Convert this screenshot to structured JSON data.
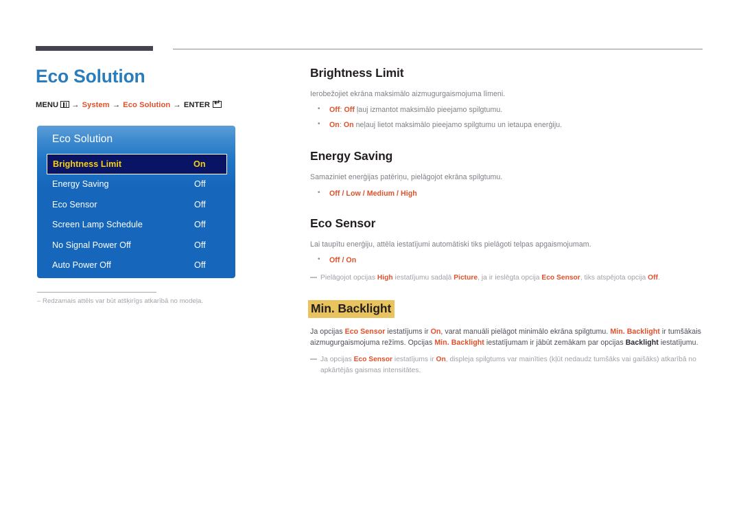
{
  "page": {
    "title": "Eco Solution",
    "breadcrumb": {
      "menu_label": "MENU",
      "menu_icon": "menu-grid-icon",
      "arrow": "→",
      "step1": "System",
      "step2": "Eco Solution",
      "enter_label": "ENTER",
      "enter_icon": "enter-key-icon"
    },
    "footnote": "Redzamais attēls var būt atšķirīgs atkarībā no modeļa."
  },
  "osd": {
    "title": "Eco Solution",
    "rows": [
      {
        "label": "Brightness Limit",
        "value": "On",
        "selected": true
      },
      {
        "label": "Energy Saving",
        "value": "Off",
        "selected": false
      },
      {
        "label": "Eco Sensor",
        "value": "Off",
        "selected": false
      },
      {
        "label": "Screen Lamp Schedule",
        "value": "Off",
        "selected": false
      },
      {
        "label": "No Signal Power Off",
        "value": "Off",
        "selected": false
      },
      {
        "label": "Auto Power Off",
        "value": "Off",
        "selected": false
      }
    ]
  },
  "sections": {
    "brightness_limit": {
      "title": "Brightness Limit",
      "intro": "Ierobežojiet ekrāna maksimālo aizmugurgaismojuma līmeni.",
      "bullet1_key": "Off",
      "bullet1_sep": ": ",
      "bullet1_val": "Off",
      "bullet1_text": " ļauj izmantot maksimālo pieejamo spilgtumu.",
      "bullet2_key": "On",
      "bullet2_sep": ": ",
      "bullet2_val": "On",
      "bullet2_text": " neļauj lietot maksimālo pieejamo spilgtumu un ietaupa enerģiju."
    },
    "energy_saving": {
      "title": "Energy Saving",
      "intro": "Samaziniet enerģijas patēriņu, pielāgojot ekrāna spilgtumu.",
      "options": "Off / Low / Medium / High"
    },
    "eco_sensor": {
      "title": "Eco Sensor",
      "intro": "Lai taupītu enerģiju, attēla iestatījumi automātiski tiks pielāgoti telpas apgaismojumam.",
      "options": "Off / On",
      "note_p1": "Pielāgojot opcijas ",
      "note_b1": "High",
      "note_p2": " iestatījumu sadaļā ",
      "note_b2": "Picture",
      "note_p3": ", ja ir ieslēgta opcija ",
      "note_b3": "Eco Sensor",
      "note_p4": ", tiks atspējota opcija ",
      "note_b4": "Off",
      "note_p5": "."
    },
    "min_backlight": {
      "title": "Min. Backlight",
      "p1_a": "Ja opcijas ",
      "p1_b1": "Eco Sensor",
      "p1_b": " iestatījums ir ",
      "p1_b2": "On",
      "p1_c": ", varat manuāli pielāgot minimālo ekrāna spilgtumu. ",
      "p1_b3": "Min. Backlight",
      "p1_d": " ir tumšākais aizmugurgaismojuma režīms. Opcijas ",
      "p1_b4": "Min. Backlight",
      "p1_e": " iestatījumam ir jābūt zemākam par opcijas ",
      "p1_b5": "Backlight",
      "p1_f": " iestatījumu.",
      "note_a": "Ja opcijas ",
      "note_b1": "Eco Sensor",
      "note_b": " iestatījums ir ",
      "note_b2": "On",
      "note_c": ", displeja spilgtums var mainīties (kļūt nedaudz tumšāks vai gaišāks) atkarībā no apkārtējās gaismas intensitātes."
    }
  },
  "colors": {
    "title_blue": "#2b7cba",
    "accent_orange": "#e1502a",
    "osd_blue": "#1667bc",
    "osd_selected_bg": "#0a1464",
    "osd_selected_text": "#f6cf16",
    "highlight_gold": "#e9c45e",
    "rule_dark": "#454350"
  }
}
